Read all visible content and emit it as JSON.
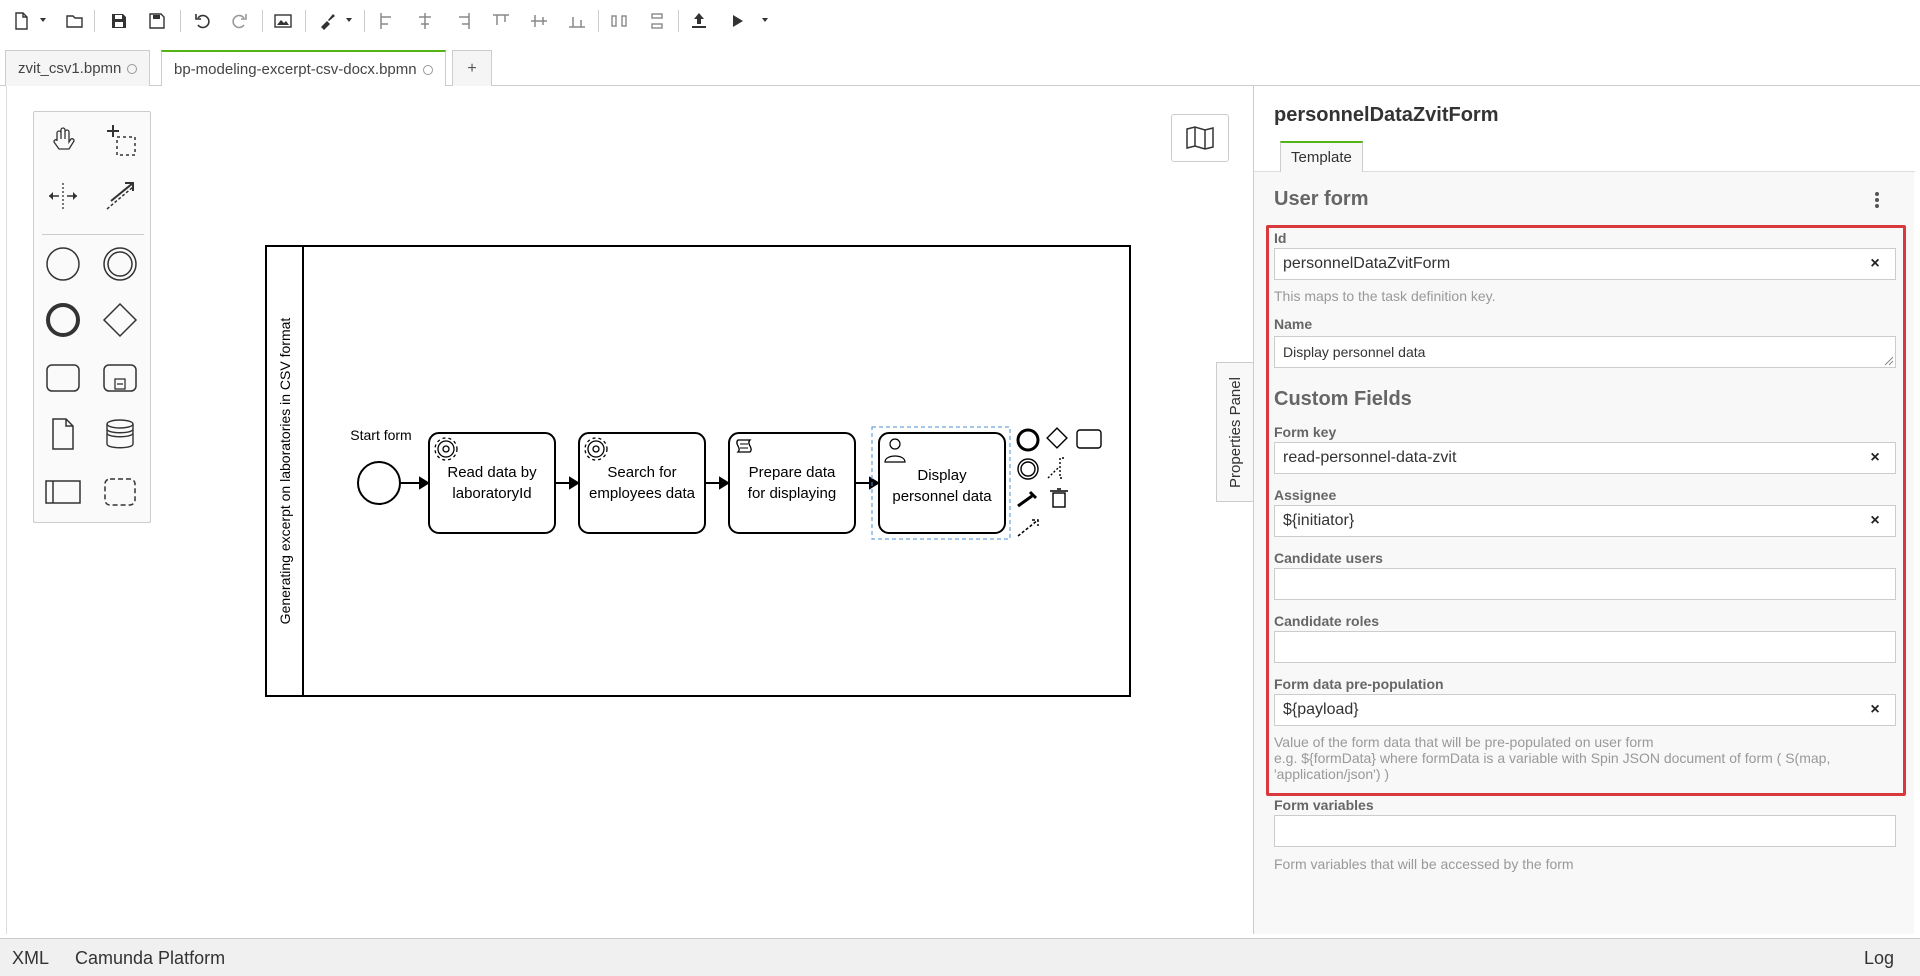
{
  "tabs": [
    {
      "label": "zvit_csv1.bpmn"
    },
    {
      "label": "bp-modeling-excerpt-csv-docx.bpmn"
    }
  ],
  "tab_add": "+",
  "diagram": {
    "pool_label": "Generating excerpt on laboratories in CSV format",
    "start_event_label": "Start form",
    "tasks": [
      {
        "line1": "Read data by",
        "line2": "laboratoryId"
      },
      {
        "line1": "Search for",
        "line2": "employees data"
      },
      {
        "line1": "Prepare data",
        "line2": "for displaying"
      },
      {
        "line1": "Display",
        "line2": "personnel data"
      }
    ]
  },
  "properties_toggle": "Properties Panel",
  "panel": {
    "title": "personnelDataZvitForm",
    "tab": "Template",
    "section": "User form",
    "id_label": "Id",
    "id_value": "personnelDataZvitForm",
    "id_hint": "This maps to the task definition key.",
    "name_label": "Name",
    "name_value": "Display personnel data",
    "custom_fields": "Custom Fields",
    "form_key_label": "Form key",
    "form_key_value": "read-personnel-data-zvit",
    "assignee_label": "Assignee",
    "assignee_value": "${initiator}",
    "candidate_users_label": "Candidate users",
    "candidate_users_value": "",
    "candidate_roles_label": "Candidate roles",
    "candidate_roles_value": "",
    "prepop_label": "Form data pre-population",
    "prepop_value": "${payload}",
    "prepop_hint1": "Value of the form data that will be pre-populated on user form",
    "prepop_hint2": "e.g. ${formData} where formData is a variable with Spin JSON document of form ( S(map, 'application/json') )",
    "form_vars_label": "Form variables",
    "form_vars_value": "",
    "form_vars_hint": "Form variables that will be accessed by the form",
    "clear": "×"
  },
  "statusbar": {
    "xml": "XML",
    "platform": "Camunda Platform",
    "log": "Log"
  },
  "colors": {
    "accent": "#52b415",
    "highlight": "#d9393d"
  }
}
